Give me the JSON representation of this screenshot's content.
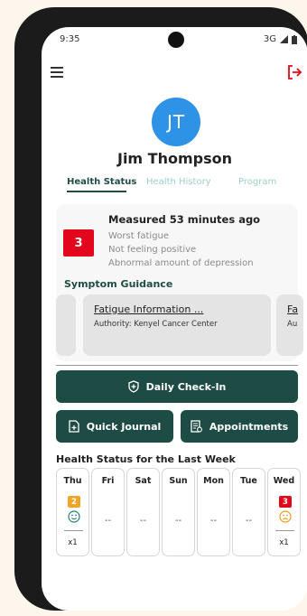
{
  "status_bar": {
    "time": "9:35",
    "network": "3G"
  },
  "user": {
    "initials": "JT",
    "name": "Jim Thompson"
  },
  "tabs": [
    {
      "label": "Health Status",
      "active": true
    },
    {
      "label": "Health History",
      "active": false
    },
    {
      "label": "Program",
      "active": false
    }
  ],
  "measurement": {
    "score": "3",
    "headline": "Measured 53 minutes ago",
    "details": [
      "Worst fatigue",
      "Not feeling positive",
      "Abnormal amount of depression"
    ]
  },
  "guidance": {
    "title": "Symptom Guidance",
    "cards": [
      {
        "title": "Fatigue Information ...",
        "author": "Authority: Kenyel Cancer Center"
      },
      {
        "title": "Fa",
        "author": "Au"
      }
    ]
  },
  "actions": {
    "checkin": "Daily Check-In",
    "journal": "Quick Journal",
    "appointments": "Appointments"
  },
  "week": {
    "title": "Health Status for the Last Week",
    "days": [
      {
        "name": "Thu",
        "score": "2",
        "count": "x1",
        "color": "#f0a528"
      },
      {
        "name": "Fri",
        "placeholder": "--"
      },
      {
        "name": "Sat",
        "placeholder": "--"
      },
      {
        "name": "Sun",
        "placeholder": "--"
      },
      {
        "name": "Mon",
        "placeholder": "--"
      },
      {
        "name": "Tue",
        "placeholder": "--"
      },
      {
        "name": "Wed",
        "score": "3",
        "count": "x1",
        "color": "#e3071d"
      }
    ]
  },
  "colors": {
    "primary": "#1d4c44",
    "accent_blue": "#2e93e6",
    "alert_red": "#e3071d",
    "warning_orange": "#f0a528"
  },
  "icons": [
    "menu-icon",
    "logout-icon",
    "shield-icon",
    "journal-icon",
    "appointments-icon",
    "smiley-icon"
  ]
}
